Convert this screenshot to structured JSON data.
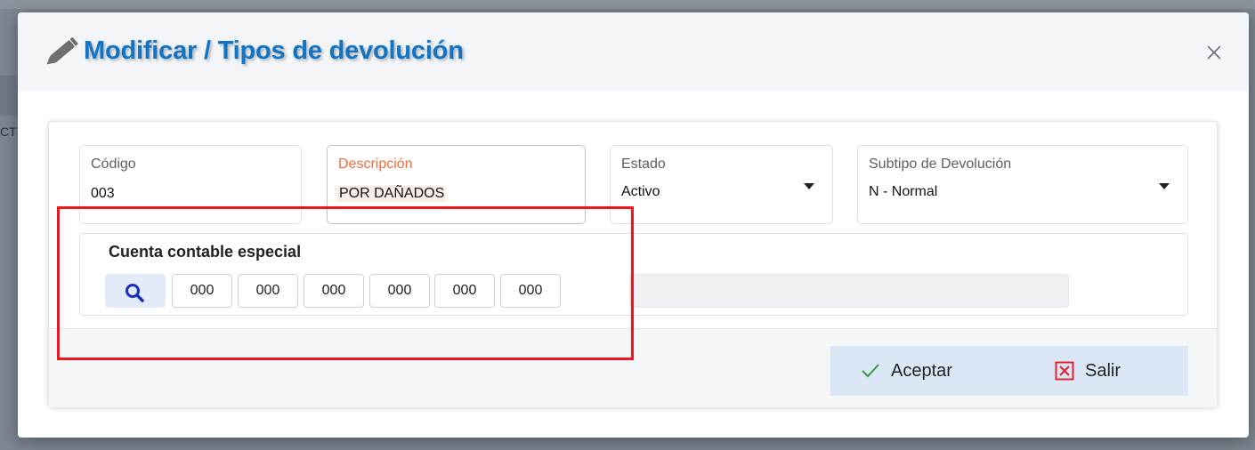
{
  "background": {
    "left_text": "CT"
  },
  "modal": {
    "title": "Modificar / Tipos de devolución",
    "icons": {
      "title": "pencil-icon",
      "close": "close-icon"
    }
  },
  "fields": {
    "codigo": {
      "label": "Código",
      "value": "003"
    },
    "descripcion": {
      "label": "Descripción",
      "value": "POR DAÑADOS"
    },
    "estado": {
      "label": "Estado",
      "value": "Activo"
    },
    "subtipo": {
      "label": "Subtipo de Devolución",
      "value": "N - Normal"
    }
  },
  "cuenta": {
    "title": "Cuenta contable especial",
    "segments": [
      "000",
      "000",
      "000",
      "000",
      "000",
      "000"
    ],
    "name": ""
  },
  "buttons": {
    "accept": "Aceptar",
    "exit": "Salir"
  },
  "colors": {
    "title": "#1274c4",
    "focused_label": "#f26b3a",
    "highlight": "#f0141e",
    "accept_icon": "#2e9d3a",
    "exit_icon": "#e0212e",
    "search_icon": "#1a2fbf"
  }
}
